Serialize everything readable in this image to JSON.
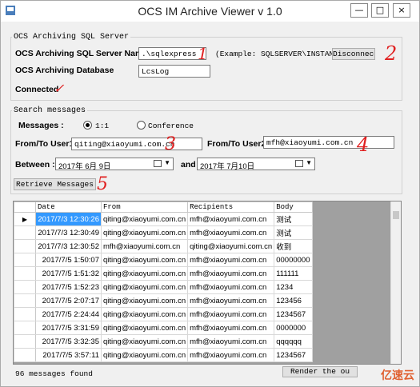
{
  "window": {
    "title": "OCS IM Archive Viewer v 1.0",
    "controls": {
      "minimize": "—",
      "maximize": "□",
      "close": "×"
    }
  },
  "sql_group": {
    "label": "OCS Archiving SQL Server",
    "server_name_label": "OCS Archiving SQL Server Name :",
    "server_name_value": ".\\sqlexpress",
    "example_text": "(Example: SQLSERVER\\INSTANCE)",
    "disconnect_label": "Disconnect",
    "database_label": "OCS Archiving Database",
    "database_value": "LcsLog",
    "status_text": "Connected"
  },
  "search_group": {
    "label": "Search messages",
    "messages_label": "Messages :",
    "radio_1to1": "1:1",
    "radio_conference": "Conference",
    "user1_label": "From/To User1:",
    "user1_value": "qiting@xiaoyumi.com.cn",
    "user2_label": "From/To User2:",
    "user2_value": "mfh@xiaoyumi.com.cn",
    "between_label": "Between :",
    "date_from": "2017年 6月 9日",
    "and_label": "and",
    "date_to": "2017年 7月10日",
    "retrieve_label": "Retrieve Messages"
  },
  "annotations": [
    "1",
    "2",
    "✓",
    "3",
    "4",
    "5"
  ],
  "grid": {
    "columns": [
      "Date",
      "From",
      "Recipients",
      "Body"
    ],
    "rows": [
      [
        "2017/7/3 12:30:26",
        "qiting@xiaoyumi.com.cn",
        "mfh@xiaoyumi.com.cn",
        "测试"
      ],
      [
        "2017/7/3 12:30:49",
        "qiting@xiaoyumi.com.cn",
        "mfh@xiaoyumi.com.cn",
        "测试"
      ],
      [
        "2017/7/3 12:30:52",
        "mfh@xiaoyumi.com.cn",
        "qiting@xiaoyumi.com.cn",
        "收到"
      ],
      [
        "2017/7/5 1:50:07",
        "qiting@xiaoyumi.com.cn",
        "mfh@xiaoyumi.com.cn",
        "00000000"
      ],
      [
        "2017/7/5 1:51:32",
        "qiting@xiaoyumi.com.cn",
        "mfh@xiaoyumi.com.cn",
        "111111"
      ],
      [
        "2017/7/5 1:52:23",
        "qiting@xiaoyumi.com.cn",
        "mfh@xiaoyumi.com.cn",
        "1234"
      ],
      [
        "2017/7/5 2:07:17",
        "qiting@xiaoyumi.com.cn",
        "mfh@xiaoyumi.com.cn",
        "123456"
      ],
      [
        "2017/7/5 2:24:44",
        "qiting@xiaoyumi.com.cn",
        "mfh@xiaoyumi.com.cn",
        "1234567"
      ],
      [
        "2017/7/5 3:31:59",
        "qiting@xiaoyumi.com.cn",
        "mfh@xiaoyumi.com.cn",
        "0000000"
      ],
      [
        "2017/7/5 3:32:35",
        "qiting@xiaoyumi.com.cn",
        "mfh@xiaoyumi.com.cn",
        "qqqqqq"
      ],
      [
        "2017/7/5 3:57:11",
        "qiting@xiaoyumi.com.cn",
        "mfh@xiaoyumi.com.cn",
        "1234567"
      ]
    ],
    "selected_row_marker": "▶"
  },
  "footer": {
    "status": "96 messages found",
    "render_button": "Render the ou",
    "logo_text": "亿速云"
  },
  "colors": {
    "selection": "#3399ff",
    "annotation": "#e02020"
  }
}
